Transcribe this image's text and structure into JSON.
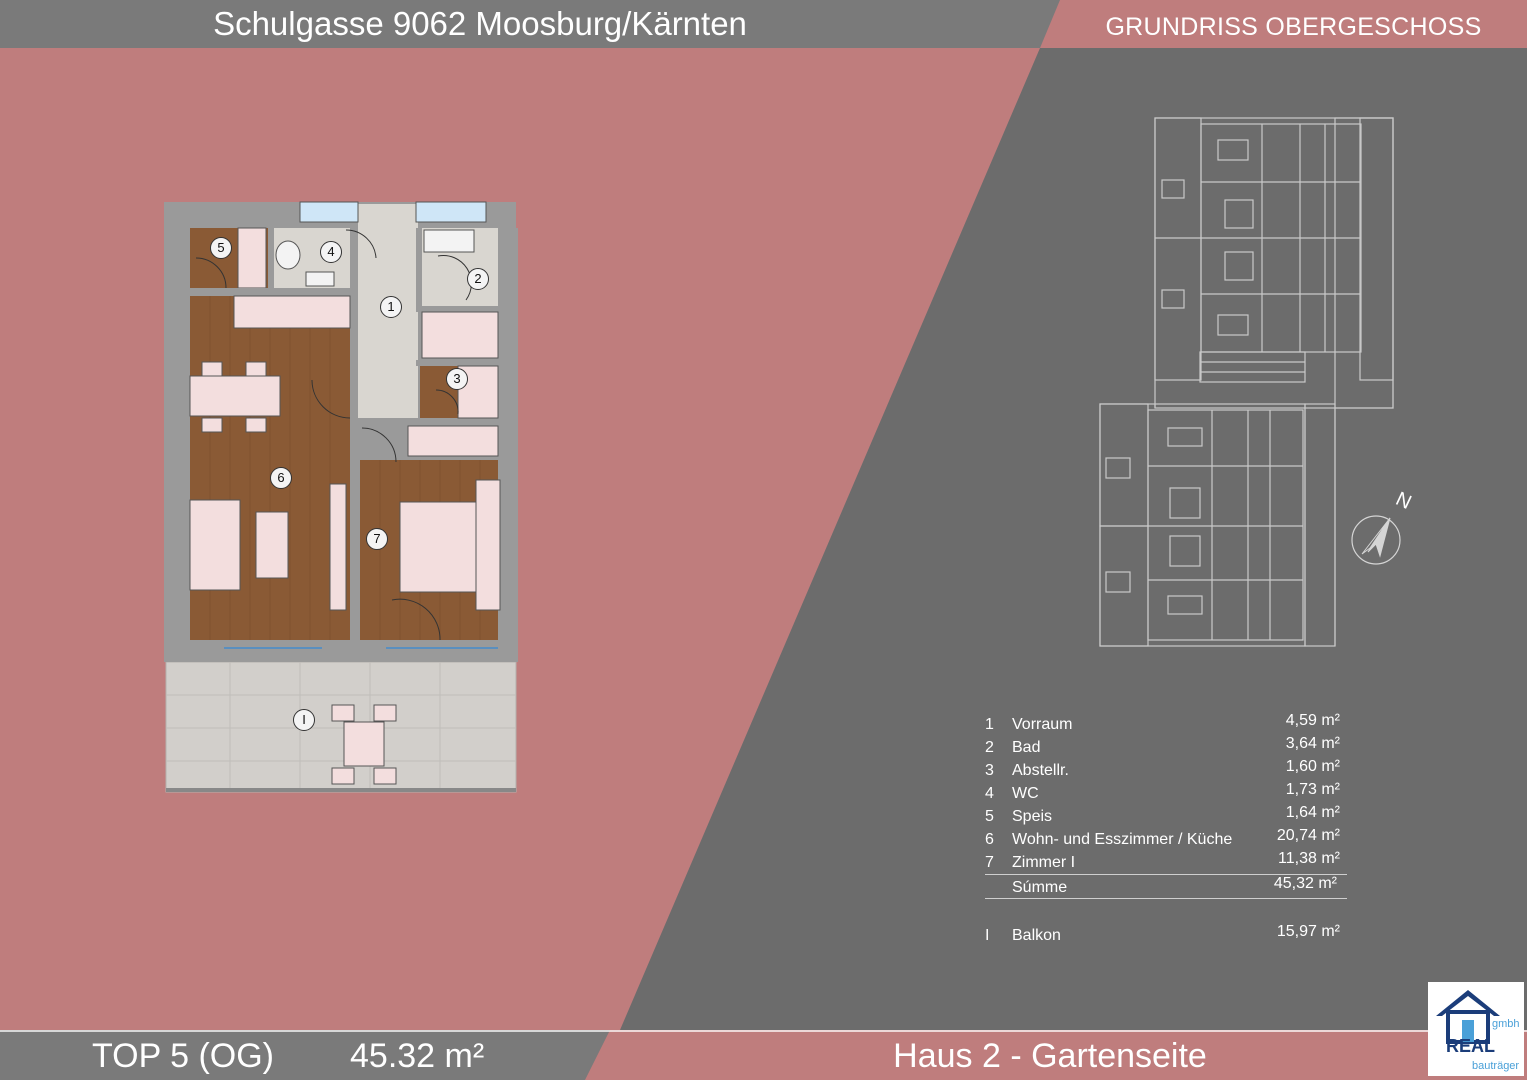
{
  "header": {
    "address": "Schulgasse 9062 Moosburg/Kärnten",
    "plan_title": "GRUNDRISS OBERGESCHOSS"
  },
  "footer": {
    "unit": "TOP 5 (OG)",
    "area": "45.32 m²",
    "house": "Haus 2 - Gartenseite"
  },
  "colors": {
    "rose": "#bf7d7d",
    "dark": "#6c6c6c",
    "header_gray": "#7a7a7a",
    "floor_wood": "#8a5a35",
    "tile": "#d9d6d0"
  },
  "plan_labels": [
    "1",
    "2",
    "3",
    "4",
    "5",
    "6",
    "7",
    "I"
  ],
  "rooms": [
    {
      "num": "1",
      "name": "Vorraum",
      "area": "4,59 m²"
    },
    {
      "num": "2",
      "name": "Bad",
      "area": "3,64 m²"
    },
    {
      "num": "3",
      "name": "Abstellr.",
      "area": "1,60 m²"
    },
    {
      "num": "4",
      "name": "WC",
      "area": "1,73 m²"
    },
    {
      "num": "5",
      "name": "Speis",
      "area": "1,64 m²"
    },
    {
      "num": "6",
      "name": "Wohn- und Esszimmer / Küche",
      "area": "20,74 m²"
    },
    {
      "num": "7",
      "name": "Zimmer I",
      "area": "11,38 m²"
    }
  ],
  "sum": {
    "label": "Súmme",
    "area": "45,32 m²"
  },
  "balcony": {
    "num": "I",
    "name": "Balkon",
    "area": "15,97 m²"
  },
  "compass": {
    "label": "N"
  },
  "logo": {
    "brand": "REAL",
    "suffix": "gmbh",
    "sub": "bauträger"
  }
}
